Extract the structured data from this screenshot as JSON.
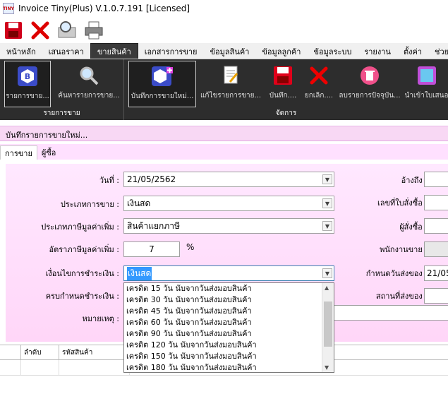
{
  "window": {
    "title": "Invoice Tiny(Plus)  V.1.0.7.191 [Licensed]",
    "icon_text": "TINY"
  },
  "quickbar": [
    "save-icon",
    "close-icon",
    "preview-icon",
    "print-icon"
  ],
  "menu": {
    "tabs": [
      "หน้าหลัก",
      "เสนอราคา",
      "ขายสินค้า",
      "เอกสารการขาย",
      "ข้อมูลสินค้า",
      "ข้อมูลลูกค้า",
      "ข้อมูลระบบ",
      "รายงาน",
      "ตั้งค่า",
      "ช่วยเหลือ"
    ],
    "active_index": 2
  },
  "ribbon": {
    "group1": {
      "label": "รายการขาย",
      "buttons": [
        "รายการขาย...",
        "ค้นหารายการขาย..."
      ]
    },
    "group2": {
      "label": "จัดการ",
      "buttons": [
        "บันทึกการขายใหม่...",
        "แก้ไขรายการขาย...",
        "บันทึก....",
        "ยกเลิก....",
        "ลบรายการปัจจุบัน...",
        "นำเข้าใบเสนอ"
      ]
    }
  },
  "document": {
    "title": "บันทึกรายการขายใหม่..."
  },
  "subtabs": [
    "การขาย",
    "ผู้ซื้อ"
  ],
  "form": {
    "date_label": "วันที่ :",
    "date_value": "21/05/2562",
    "sale_type_label": "ประเภทการขาย :",
    "sale_type_value": "เงินสด",
    "vat_type_label": "ประเภทภาษีมูลค่าเพิ่ม :",
    "vat_type_value": "สินค้าแยกภาษี",
    "vat_rate_label": "อัตราภาษีมูลค่าเพิ่ม :",
    "vat_rate_value": "7",
    "vat_rate_unit": "%",
    "payment_terms_label": "เงื่อนไขการชำระเงิน :",
    "payment_terms_value": "เงินสด",
    "due_date_label": "ครบกำหนดชำระเงิน :",
    "note_label": "หมายเหตุ :",
    "reference_label": "อ้างถึง :",
    "po_number_label": "เลขที่ใบสั่งซื้อ :",
    "ordered_by_label": "ผู้สั่งซื้อ :",
    "salesperson_label": "พนักงานขาย :",
    "delivery_date_label": "กำหนดวันส่งของ :",
    "delivery_date_value": "21/05",
    "delivery_place_label": "สถานที่ส่งของ :"
  },
  "payment_terms_options": [
    "เครดิต 15 วัน นับจากวันส่งมอบสินค้า",
    "เครดิต 30 วัน นับจากวันส่งมอบสินค้า",
    "เครดิต 45 วัน นับจากวันส่งมอบสินค้า",
    "เครดิต 60 วัน นับจากวันส่งมอบสินค้า",
    "เครดิต 90 วัน นับจากวันส่งมอบสินค้า",
    "เครดิต 120 วัน นับจากวันส่งมอบสินค้า",
    "เครดิต 150 วัน นับจากวันส่งมอบสินค้า",
    "เครดิต 180 วัน นับจากวันส่งมอบสินค้า"
  ],
  "grid": {
    "columns": [
      "ลำดับ",
      "รหัสสินค้า"
    ]
  },
  "colors": {
    "ribbon_bg": "#2d2d2d",
    "form_bg": "#ffd6f8",
    "selection": "#3399ff"
  }
}
